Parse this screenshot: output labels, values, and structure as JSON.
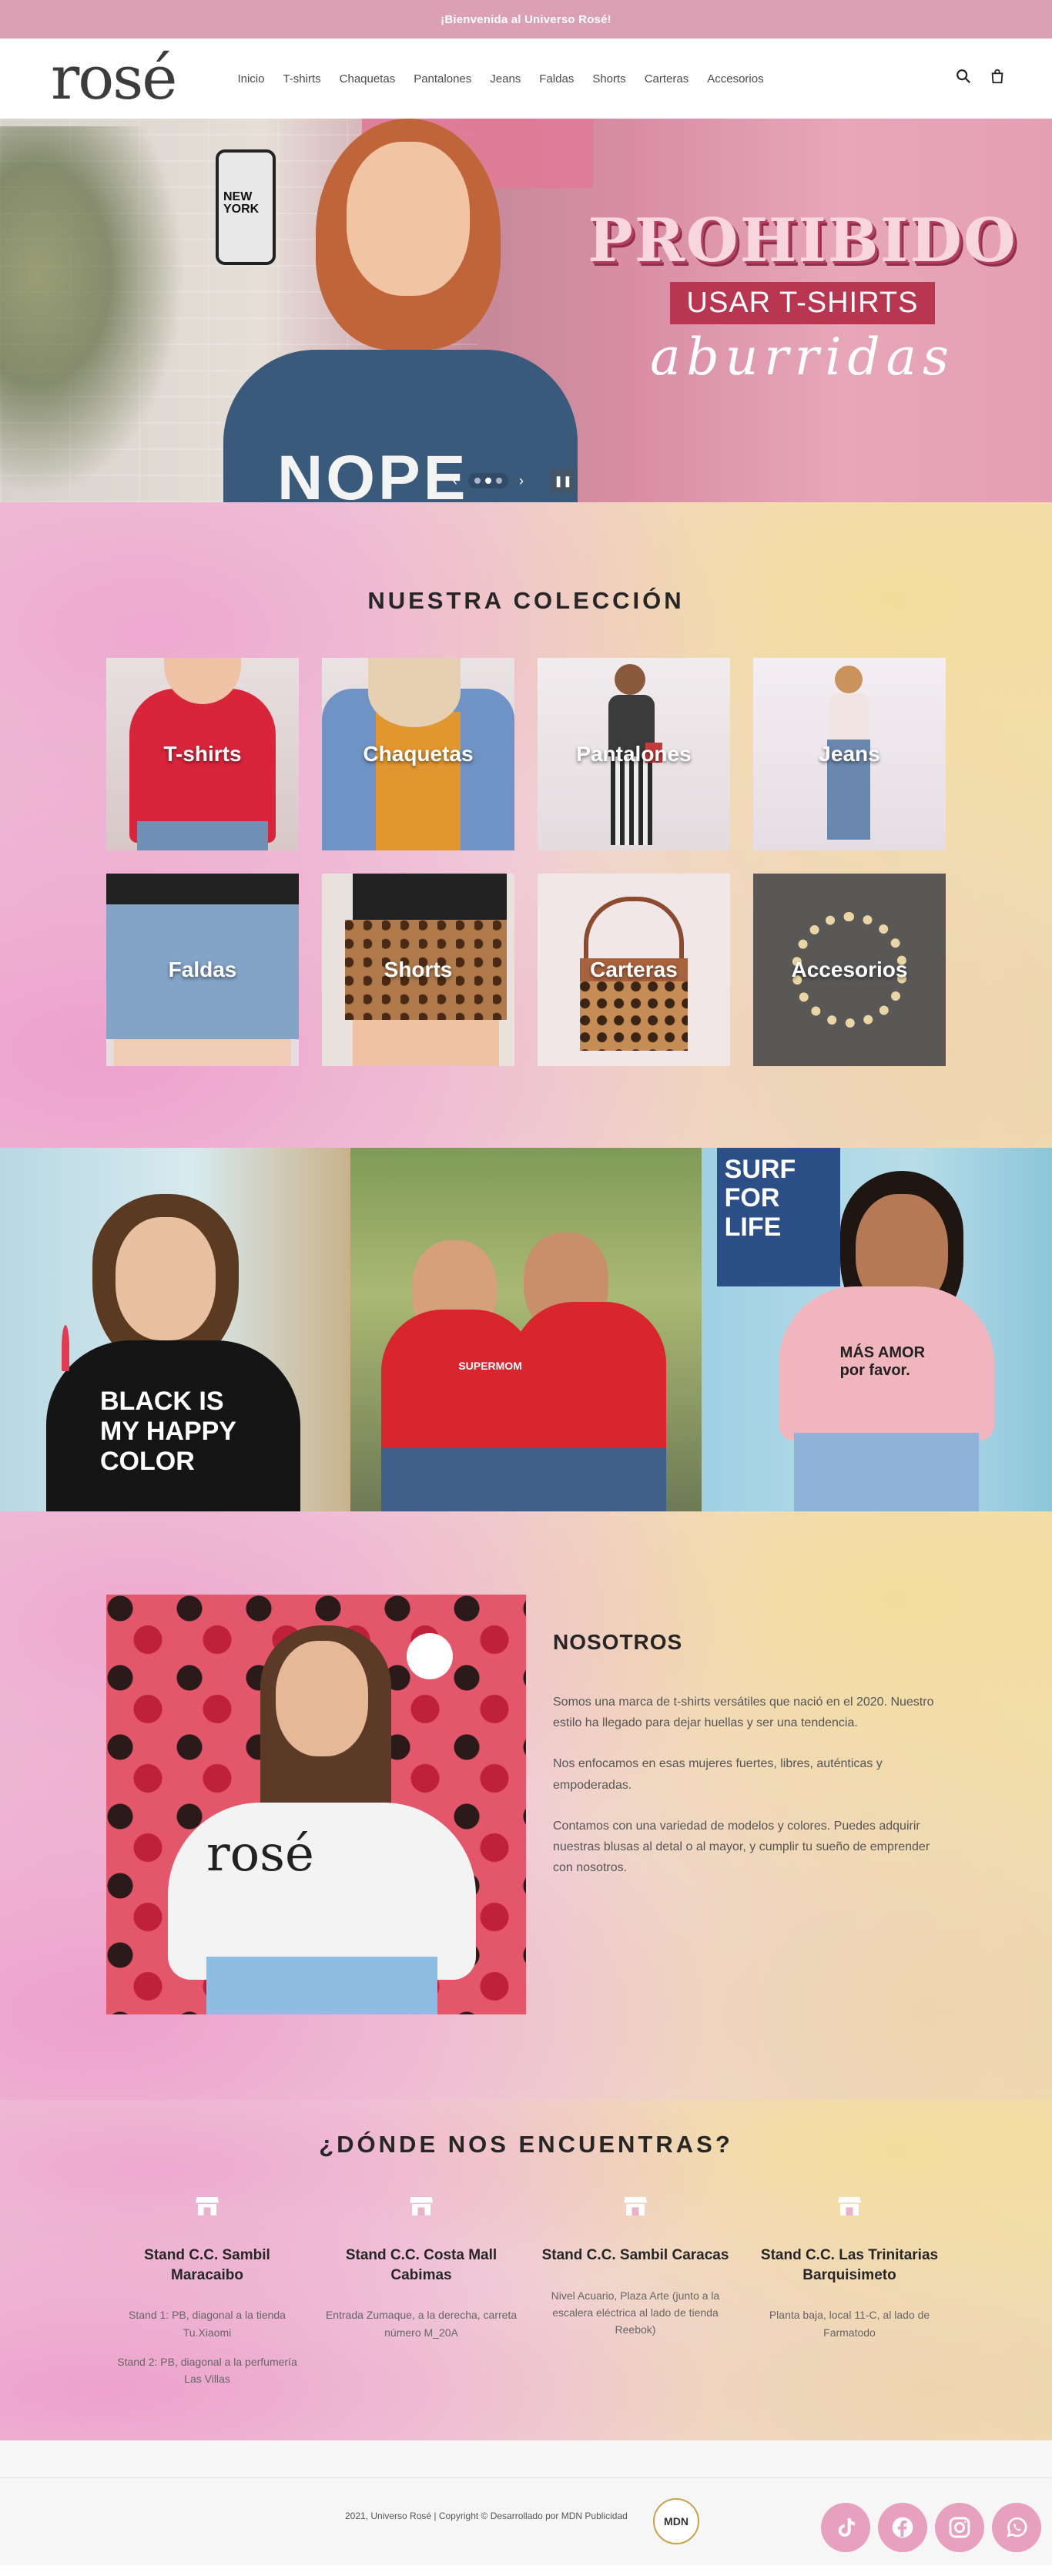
{
  "announcement": {
    "text": "¡Bienvenida al Universo Rosé!"
  },
  "header": {
    "logo": "rosé",
    "nav": [
      "Inicio",
      "T-shirts",
      "Chaquetas",
      "Pantalones",
      "Jeans",
      "Faldas",
      "Shorts",
      "Carteras",
      "Accesorios"
    ],
    "icons": [
      "search-icon",
      "cart-icon"
    ]
  },
  "hero": {
    "title": "PROHIBIDO",
    "subtitle": "USAR T-SHIRTS",
    "script": "aburridas",
    "phone_text": "NEW YORK",
    "shirt_text": "NOPE",
    "slides": 3,
    "active_slide": 2,
    "prev_glyph": "‹",
    "next_glyph": "›",
    "pause_glyph": "❚❚"
  },
  "collection": {
    "title": "NUESTRA COLECCIÓN",
    "items": [
      "T-shirts",
      "Chaquetas",
      "Pantalones",
      "Jeans",
      "Faldas",
      "Shorts",
      "Carteras",
      "Accesorios"
    ]
  },
  "gallery": {
    "photo1_text": "BLACK IS MY HAPPY COLOR",
    "photo2_text": "SUPERMOM",
    "photo3_text": "MÁS AMOR por favor.",
    "photo3_sign": "SURF FOR LIFE"
  },
  "about": {
    "heading": "NOSOTROS",
    "shirt_logo": "rosé",
    "paragraphs": [
      "Somos una marca de t-shirts versátiles que nació en el 2020. Nuestro estilo ha llegado para dejar huellas y ser una tendencia.",
      "Nos enfocamos en esas mujeres fuertes, libres, auténticas y empoderadas.",
      "Contamos con una variedad de modelos y colores. Puedes adquirir nuestras blusas al detal o al mayor, y cumplir tu sueño de emprender con nosotros."
    ]
  },
  "locations": {
    "title": "¿DÓNDE NOS ENCUENTRAS?",
    "stores": [
      {
        "name": "Stand C.C. Sambil Maracaibo",
        "details": [
          "Stand 1: PB, diagonal a la tienda Tu.Xiaomi",
          "Stand 2: PB, diagonal a la perfumería Las Villas"
        ]
      },
      {
        "name": "Stand C.C. Costa Mall Cabimas",
        "details": [
          "Entrada Zumaque, a la derecha, carreta número M_20A"
        ]
      },
      {
        "name": "Stand C.C. Sambil Caracas",
        "details": [
          "Nivel Acuario, Plaza Arte (junto a la escalera eléctrica al lado de tienda Reebok)"
        ]
      },
      {
        "name": "Stand C.C. Las Trinitarias Barquisimeto",
        "details": [
          "Planta baja, local 11-C, al lado de Farmatodo"
        ]
      }
    ]
  },
  "footer": {
    "copyright": "2021, Universo Rosé | Copyright © Desarrollado por MDN Publicidad",
    "mdn_logo": "MDN",
    "socials": [
      "tiktok-icon",
      "facebook-icon",
      "instagram-icon",
      "whatsapp-icon"
    ]
  },
  "colors": {
    "announce_bg": "#dca0b5",
    "accent": "#b8364f",
    "social_bg": "#e7a0bd"
  }
}
